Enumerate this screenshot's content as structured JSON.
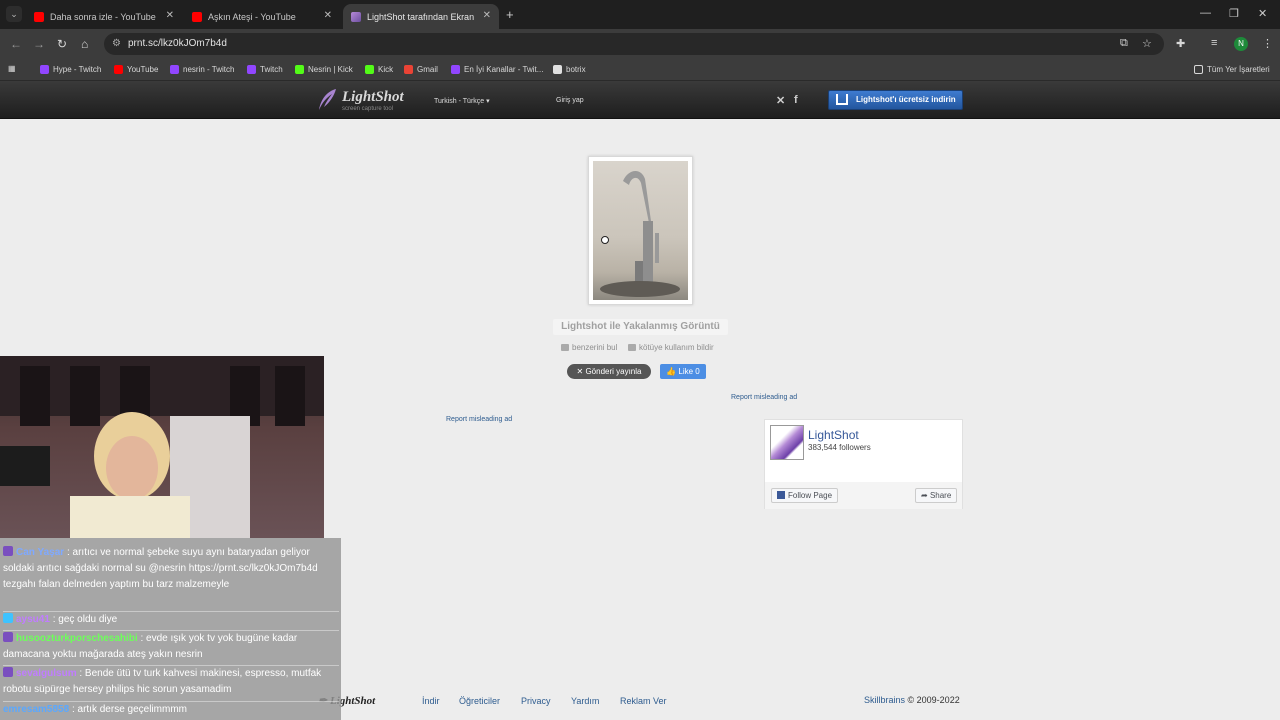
{
  "browser": {
    "tabs": [
      {
        "label": "Daha sonra izle - YouTube"
      },
      {
        "label": "Aşkın Ateşi - YouTube"
      },
      {
        "label": "LightShot tarafından Ekran Görüntüsü"
      }
    ],
    "url": "prnt.sc/lkz0kJOm7b4d",
    "bookmarks": [
      {
        "label": "Hype - Twitch",
        "icon": "twitch"
      },
      {
        "label": "YouTube",
        "icon": "youtube"
      },
      {
        "label": "nesrin - Twitch",
        "icon": "twitch"
      },
      {
        "label": "Twitch",
        "icon": "twitch"
      },
      {
        "label": "Nesrin | Kick",
        "icon": "kick"
      },
      {
        "label": "Kick",
        "icon": "kick"
      },
      {
        "label": "Gmail",
        "icon": "gmail"
      },
      {
        "label": "En İyi Kanallar - Twit...",
        "icon": "twitch"
      },
      {
        "label": "botrix",
        "icon": "botrix"
      }
    ],
    "all_bookmarks": "Tüm Yer İşaretleri",
    "profile_initial": "N"
  },
  "header": {
    "logo_name": "LightShot",
    "logo_sub": "screen capture tool",
    "language": "Turkish - Türkçe",
    "login": "Giriş yap",
    "download": "Lightshot'ı ücretsiz indirin"
  },
  "main": {
    "image_title": "Lightshot ile Yakalanmış Görüntü",
    "find_similar": "benzerini bul",
    "report_abuse": "kötüye kullanım bildir",
    "tweet": "Gönderi yayınla",
    "like": "Like 0",
    "report_ad": "Report misleading ad"
  },
  "facebook": {
    "page_name": "LightShot",
    "followers": "383,544 followers",
    "follow": "Follow Page",
    "share": "Share"
  },
  "footer": {
    "logo": "LightShot",
    "links": [
      "İndir",
      "Öğreticiler",
      "Privacy",
      "Yardım",
      "Reklam Ver"
    ],
    "brand": "Skillbrains",
    "copyright": "© 2009-2022"
  },
  "chat": [
    {
      "user": "Can Yaşar",
      "color": "#7fa9ff",
      "text": ": arıtıcı ve normal şebeke suyu aynı bataryadan geliyor soldaki arıtıcı sağdaki normal su @nesrin https://prnt.sc/lkz0kJOm7b4d tezgahı falan delmeden yaptım bu tarz malzemeyle"
    },
    {
      "user": "aysu41",
      "color": "#c07cff",
      "text": ": geç oldu diye"
    },
    {
      "user": "husoozturkporschesahibi",
      "color": "#6dff5a",
      "text": ": evde ışık yok tv yok bugüne kadar damacana yoktu mağarada ateş yakın nesrin"
    },
    {
      "user": "sevalgulsum",
      "color": "#c07cff",
      "text": ": Bende ütü tv turk kahvesi makinesi, espresso, mutfak robotu süpürge hersey philips hic sorun yasamadim"
    },
    {
      "user": "emresam5858",
      "color": "#5aa8ff",
      "text": ": artık derse geçelimmmm"
    }
  ]
}
